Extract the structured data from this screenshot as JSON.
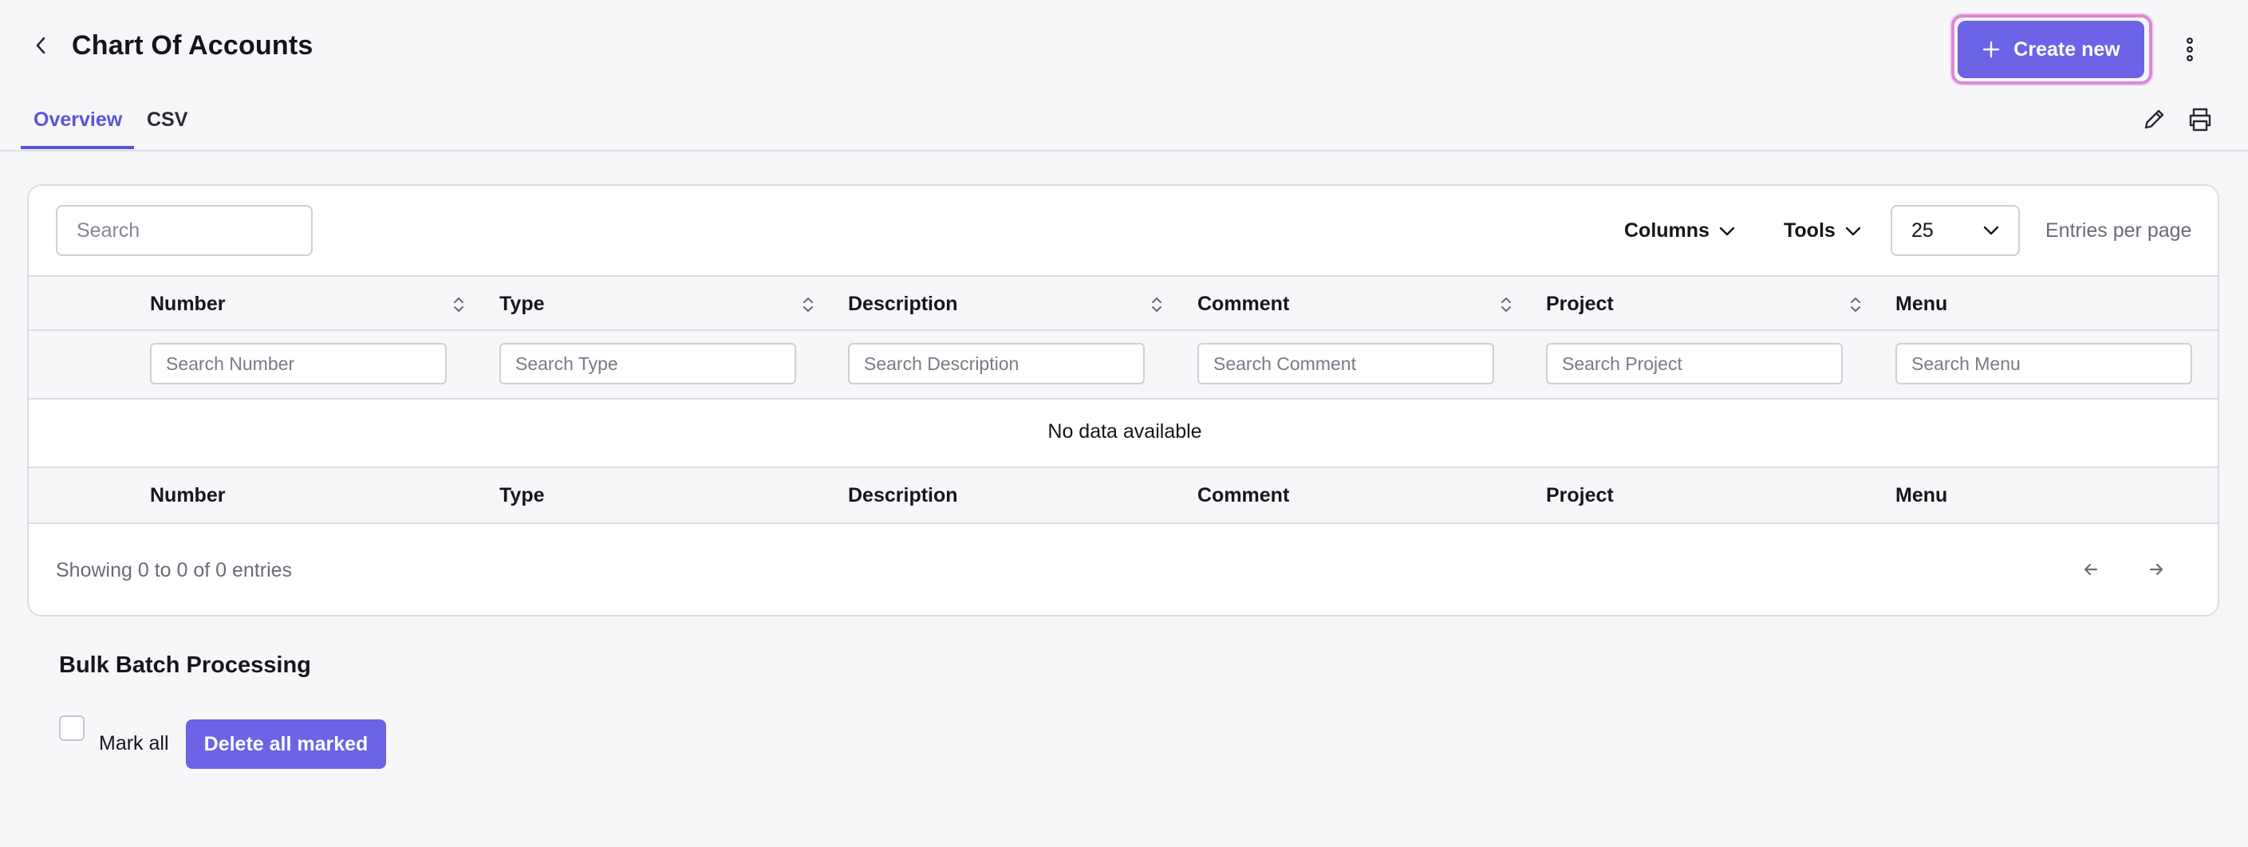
{
  "header": {
    "title": "Chart Of Accounts",
    "create_label": "Create new"
  },
  "tabs": [
    {
      "label": "Overview",
      "active": true
    },
    {
      "label": "CSV",
      "active": false
    }
  ],
  "toolbar": {
    "search_placeholder": "Search",
    "columns_label": "Columns",
    "tools_label": "Tools",
    "per_page_value": "25",
    "entries_label": "Entries per page"
  },
  "table": {
    "columns": [
      "Number",
      "Type",
      "Description",
      "Comment",
      "Project",
      "Menu"
    ],
    "filters": [
      "Search Number",
      "Search Type",
      "Search Description",
      "Search Comment",
      "Search Project",
      "Search Menu"
    ],
    "empty_text": "No data available",
    "showing_text": "Showing 0 to 0 of 0 entries"
  },
  "bulk": {
    "title": "Bulk Batch Processing",
    "mark_all_label": "Mark all",
    "delete_label": "Delete all marked"
  },
  "colors": {
    "accent": "#6c63e6",
    "tab_active": "#5b55d9",
    "focus_ring": "#d889d6",
    "background": "#f7f7f9"
  },
  "icons": {
    "back": "chevron-left-icon",
    "create": "plus-icon",
    "more": "more-vertical-icon",
    "edit": "pencil-icon",
    "print": "printer-icon",
    "sort": "sort-icon",
    "dropdown": "chevron-down-icon",
    "prev": "arrow-left-icon",
    "next": "arrow-right-icon"
  }
}
